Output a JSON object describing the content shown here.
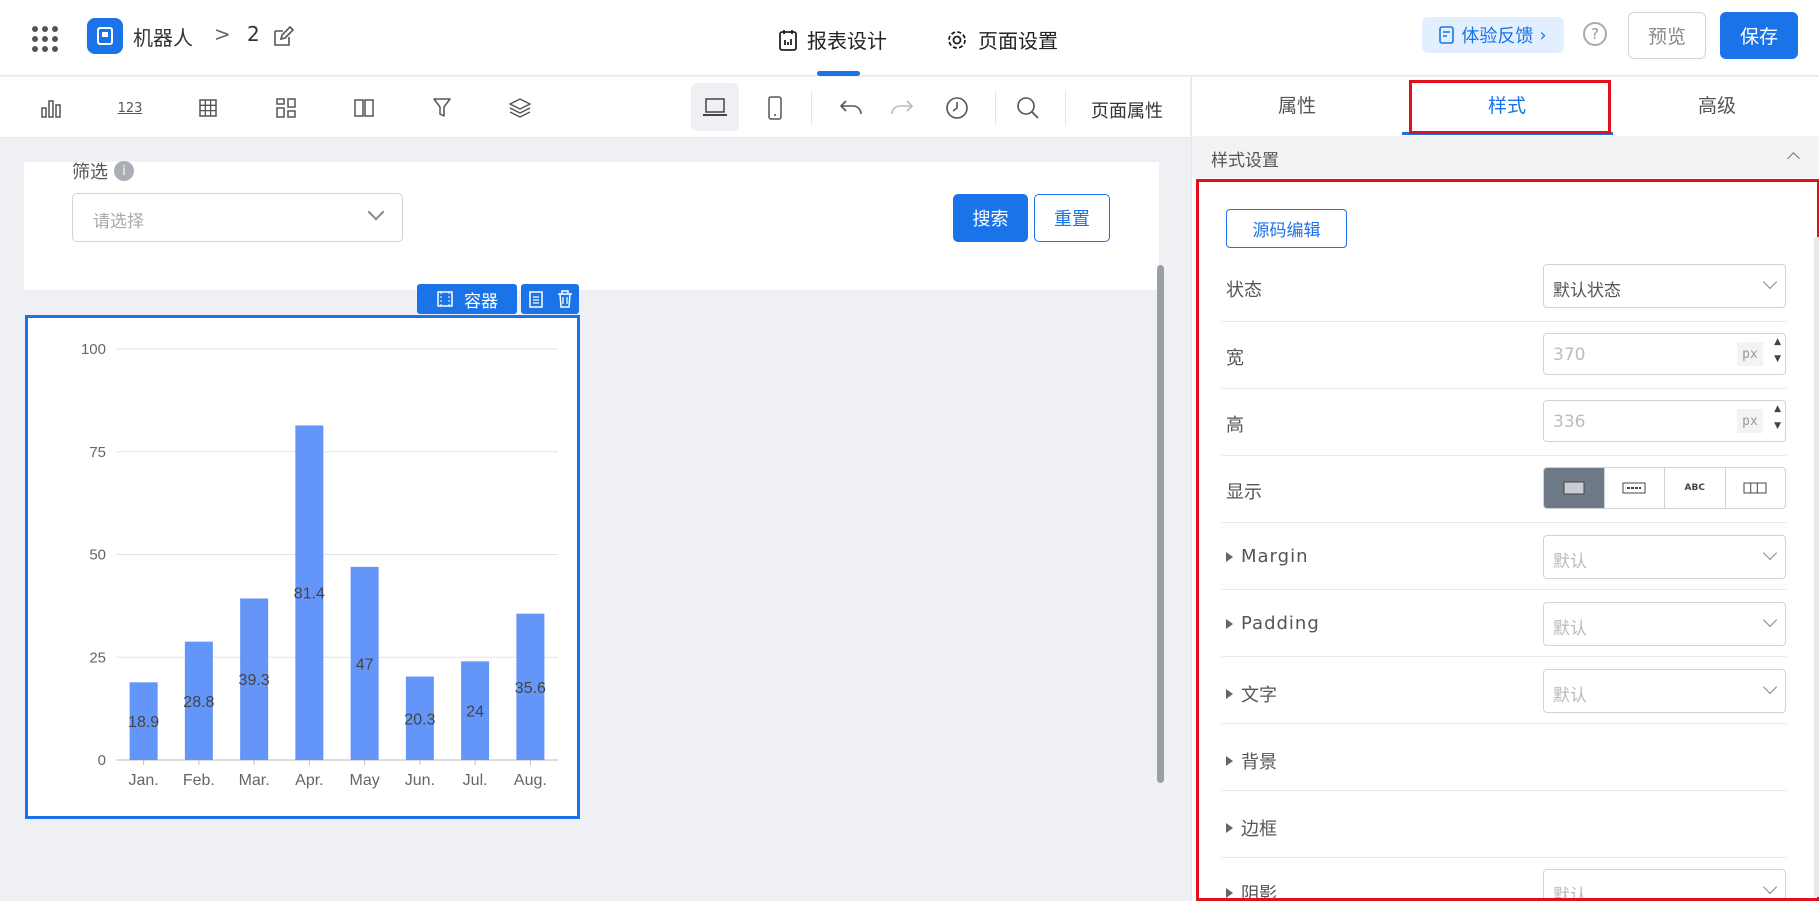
{
  "header": {
    "app_name": "机器人",
    "breadcrumb_sep": ">",
    "page_number": "2",
    "tabs": [
      {
        "label": "报表设计"
      },
      {
        "label": "页面设置"
      }
    ],
    "feedback_label": "体验反馈",
    "help_label": "?",
    "preview_label": "预览",
    "save_label": "保存"
  },
  "toolbar": {
    "tools": [
      "bar-chart-icon",
      "number-icon",
      "table-icon",
      "grid-layout-icon",
      "columns-icon",
      "filter-icon",
      "layers-icon",
      "desktop-icon",
      "mobile-icon",
      "undo-icon",
      "redo-icon",
      "history-icon",
      "search-icon"
    ],
    "number_glyph": "123",
    "page_props_label": "页面属性"
  },
  "canvas": {
    "filter_label": "筛选",
    "info_glyph": "i",
    "select_placeholder": "请选择",
    "search_label": "搜索",
    "reset_label": "重置",
    "container_label": "容器"
  },
  "chart_data": {
    "type": "bar",
    "categories": [
      "Jan.",
      "Feb.",
      "Mar.",
      "Apr.",
      "May",
      "Jun.",
      "Jul.",
      "Aug."
    ],
    "values": [
      18.9,
      28.8,
      39.3,
      81.4,
      47,
      20.3,
      24,
      35.6
    ],
    "ylim": [
      0,
      100
    ],
    "yticks": [
      0,
      25,
      50,
      75,
      100
    ],
    "grid": true,
    "bar_color": "#6495f9",
    "data_labels": true
  },
  "panel": {
    "tabs": [
      {
        "label": "属性"
      },
      {
        "label": "样式"
      },
      {
        "label": "高级"
      }
    ],
    "active_tab": "样式",
    "section_title": "样式设置",
    "source_edit_label": "源码编辑",
    "rows": {
      "state": {
        "label": "状态",
        "value": "默认状态"
      },
      "width": {
        "label": "宽",
        "value": "370",
        "unit": "px"
      },
      "height": {
        "label": "高",
        "value": "336",
        "unit": "px"
      },
      "display": {
        "label": "显示",
        "options": [
          "block",
          "ABC",
          "ABC",
          "flex"
        ]
      },
      "margin": {
        "label": "Margin",
        "value": "默认"
      },
      "padding": {
        "label": "Padding",
        "value": "默认"
      },
      "text": {
        "label": "文字",
        "value": "默认"
      },
      "background": {
        "label": "背景"
      },
      "border": {
        "label": "边框"
      },
      "shadow": {
        "label": "阴影",
        "value": "默认"
      }
    },
    "highlight_color": "#e0111a",
    "accent": "#1a73e8"
  }
}
